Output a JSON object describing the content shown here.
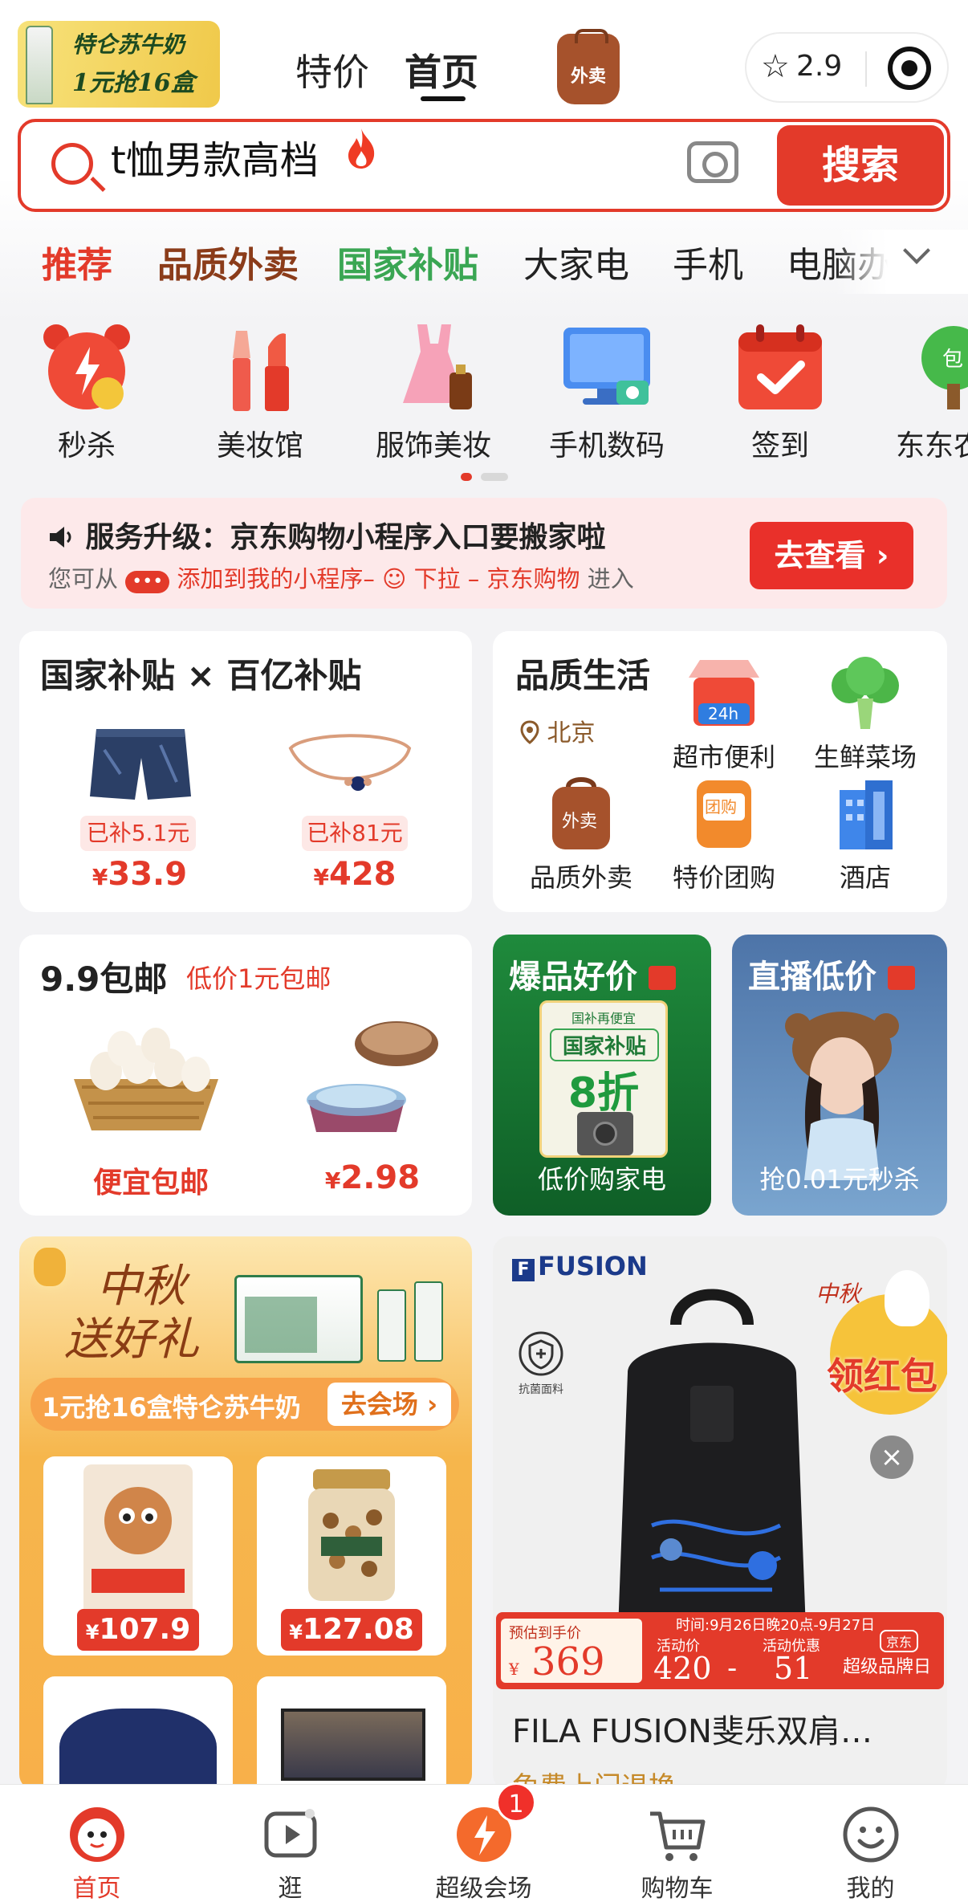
{
  "header": {
    "promo_line1": "特仑苏牛奶",
    "promo_line2": "1元抢16盒",
    "tab_special": "特价",
    "tab_home": "首页",
    "takeaway_icon_label": "外卖",
    "rating": "2.9"
  },
  "search": {
    "query": "t恤男款高档",
    "button_label": "搜索"
  },
  "categories": [
    "推荐",
    "品质外卖",
    "国家补贴",
    "大家电",
    "手机",
    "电脑办"
  ],
  "shortcuts": [
    {
      "label": "秒杀",
      "icon": "alarm-clock-icon"
    },
    {
      "label": "美妆馆",
      "icon": "lipstick-icon"
    },
    {
      "label": "服饰美妆",
      "icon": "dress-icon"
    },
    {
      "label": "手机数码",
      "icon": "monitor-camera-icon"
    },
    {
      "label": "签到",
      "icon": "calendar-check-icon"
    },
    {
      "label": "东东农场",
      "icon": "tree-icon"
    }
  ],
  "notice": {
    "title": "服务升级：京东购物小程序入口要搬家啦",
    "line2_prefix": "您可从",
    "line2_dots": "•••",
    "line2_red1": "添加到我的小程序–",
    "line2_red2": "下拉 – 京东购物",
    "line2_suffix": "进入",
    "button": "去查看"
  },
  "subsidy_card": {
    "title": "国家补贴 × 百亿补贴",
    "items": [
      {
        "tag": "已补5.1元",
        "currency": "¥",
        "price": "33.9"
      },
      {
        "tag": "已补81元",
        "currency": "¥",
        "price": "428"
      }
    ]
  },
  "quality_card": {
    "title": "品质生活",
    "location": "北京",
    "items": [
      "超市便利",
      "生鲜菜场",
      "品质外卖",
      "特价团购",
      "酒店"
    ],
    "badge_24h": "24h",
    "takeaway_text": "外卖",
    "groupbuy_text": "团购"
  },
  "free_shipping_card": {
    "title": "9.9包邮",
    "subtitle": "低价1元包邮",
    "item1_label": "便宜包邮",
    "item2_currency": "¥",
    "item2_price": "2.98"
  },
  "hot_card": {
    "title": "爆品好价",
    "poster_top": "国补再便宜",
    "poster_main": "国家补贴",
    "poster_big": "8折",
    "footer": "低价购家电"
  },
  "live_card": {
    "title": "直播低价",
    "footer": "抢0.01元秒杀"
  },
  "festival_card": {
    "title_line1": "中秋",
    "title_line2": "送好礼",
    "banner_text": "1元抢16盒特仑苏牛奶",
    "banner_button": "去会场",
    "prices": [
      "107.9",
      "127.08"
    ],
    "currency": "¥"
  },
  "fila_card": {
    "brand": "FUSION",
    "shield_caption": "抗菌面料",
    "red_packet": "领红包",
    "red_packet_top": "中秋",
    "est_label": "预估到手价",
    "est_price": "369",
    "currency": "¥",
    "time_text": "时间:9月26日晚20点-9月27日",
    "col1_label": "活动价",
    "col1_value": "420",
    "col2_label": "活动优惠",
    "col2_value": "51",
    "brand_tag_top": "京东",
    "brand_tag": "超级品牌日",
    "product_title": "FILA FUSION斐乐双肩…",
    "service": "免费上门退换"
  },
  "tabbar": {
    "items": [
      "首页",
      "逛",
      "超级会场",
      "购物车",
      "我的"
    ],
    "badge": "1"
  },
  "colors": {
    "brand_red": "#e33a2a",
    "green": "#3aa653",
    "brown": "#8b3c1a"
  }
}
